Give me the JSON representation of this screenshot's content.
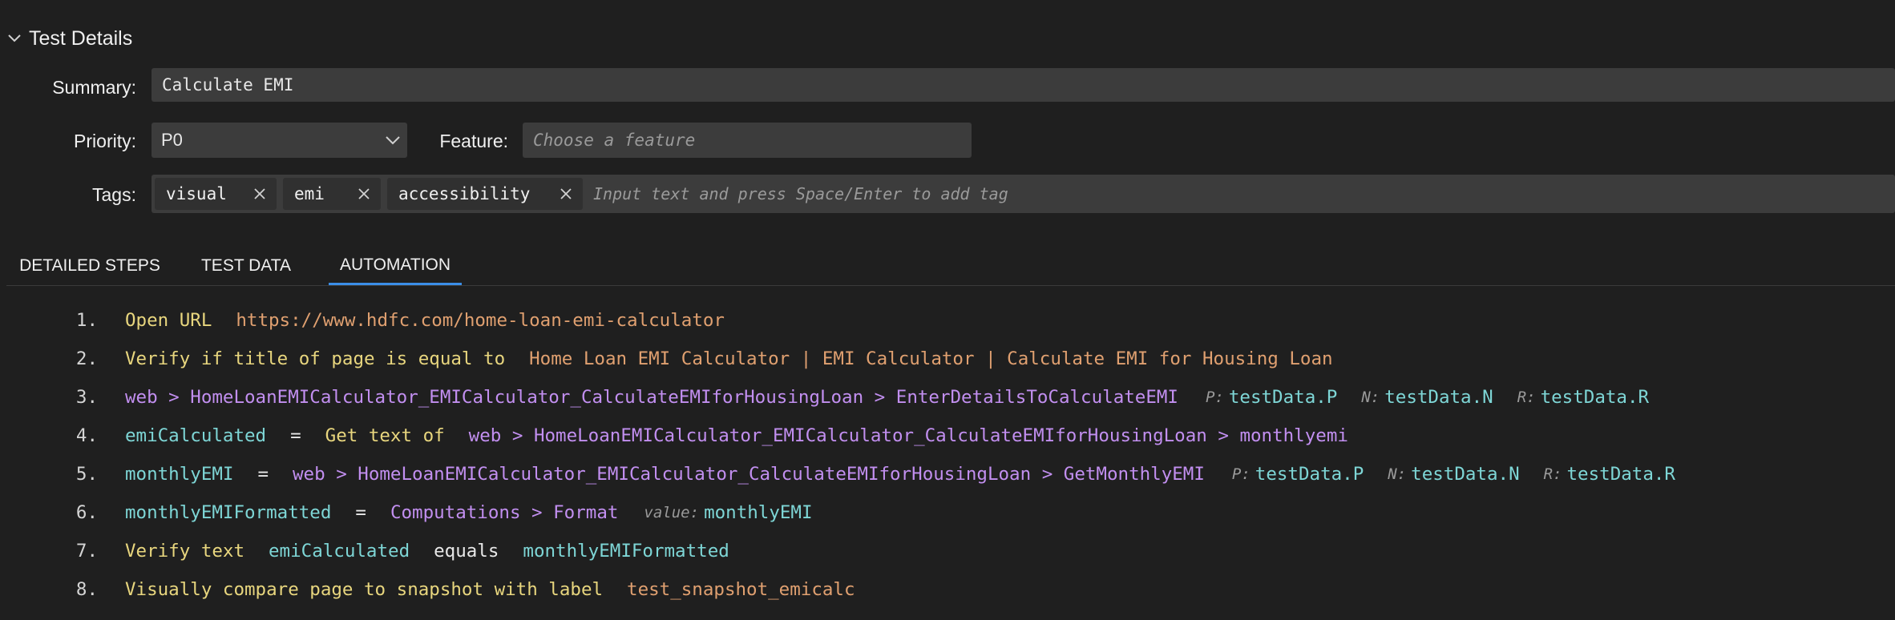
{
  "section": {
    "title": "Test Details"
  },
  "form": {
    "summary": {
      "label": "Summary:",
      "value": "Calculate EMI"
    },
    "priority": {
      "label": "Priority:",
      "value": "P0"
    },
    "feature": {
      "label": "Feature:",
      "placeholder": "Choose a feature"
    },
    "tags": {
      "label": "Tags:",
      "items": [
        "visual",
        "emi",
        "accessibility"
      ],
      "placeholder": "Input text and press Space/Enter to add tag"
    }
  },
  "tabs": [
    "DETAILED STEPS",
    "TEST DATA",
    "AUTOMATION"
  ],
  "active_tab": "AUTOMATION",
  "steps": [
    {
      "num": "1.",
      "parts": [
        "Open URL",
        "https://www.hdfc.com/home-loan-emi-calculator"
      ]
    },
    {
      "num": "2.",
      "parts": [
        "Verify if title of page is equal to",
        "Home Loan EMI Calculator | EMI Calculator | Calculate EMI for Housing Loan"
      ]
    },
    {
      "num": "3.",
      "parts": [
        "web > HomeLoanEMICalculator_EMICalculator_CalculateEMIforHousingLoan > EnterDetailsToCalculateEMI",
        "P:",
        "testData.P",
        "N:",
        "testData.N",
        "R:",
        "testData.R"
      ]
    },
    {
      "num": "4.",
      "parts": [
        "emiCalculated",
        "=",
        "Get text of",
        "web > HomeLoanEMICalculator_EMICalculator_CalculateEMIforHousingLoan > monthlyemi"
      ]
    },
    {
      "num": "5.",
      "parts": [
        "monthlyEMI",
        "=",
        "web > HomeLoanEMICalculator_EMICalculator_CalculateEMIforHousingLoan > GetMonthlyEMI",
        "P:",
        "testData.P",
        "N:",
        "testData.N",
        "R:",
        "testData.R"
      ]
    },
    {
      "num": "6.",
      "parts": [
        "monthlyEMIFormatted",
        "=",
        "Computations > Format",
        "value:",
        "monthlyEMI"
      ]
    },
    {
      "num": "7.",
      "parts": [
        "Verify text",
        "emiCalculated",
        "equals",
        "monthlyEMIFormatted"
      ]
    },
    {
      "num": "8.",
      "parts": [
        "Visually compare page to snapshot with label",
        "test_snapshot_emicalc"
      ]
    }
  ],
  "colors": {
    "background": "#1f1f1f",
    "field": "#3c3c3c",
    "accent": "#3b8ee8",
    "keyword": "#e8d67e",
    "string": "#e0a070",
    "element": "#c28ff0",
    "variable": "#7ed6d6"
  }
}
